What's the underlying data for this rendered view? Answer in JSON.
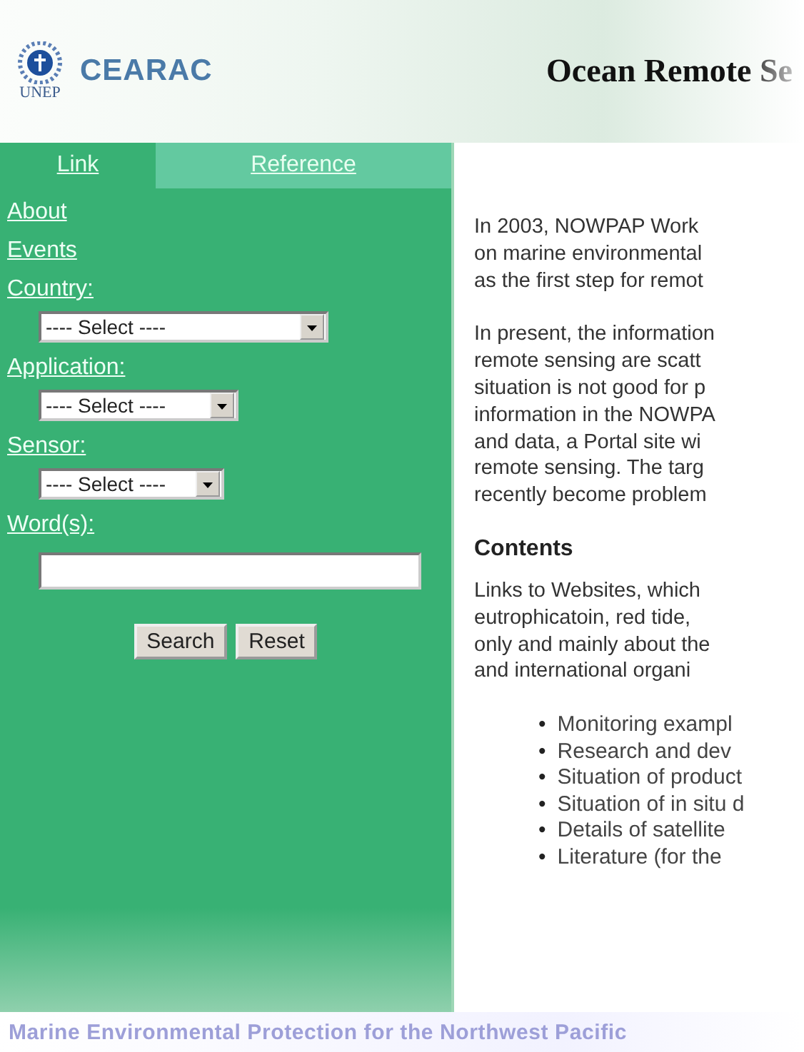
{
  "header": {
    "org": "UNEP",
    "logo_text": "CEARAC",
    "title": "Ocean Remote Se"
  },
  "tabs": [
    {
      "label": "Link",
      "selected": true
    },
    {
      "label": "Reference",
      "selected": false
    }
  ],
  "sidebar": {
    "items": [
      {
        "kind": "link",
        "label": "About"
      },
      {
        "kind": "link",
        "label": "Events"
      },
      {
        "kind": "link",
        "label": "Country:"
      },
      {
        "kind": "select",
        "value": "---- Select ----"
      },
      {
        "kind": "link",
        "label": "Application:"
      },
      {
        "kind": "select",
        "value": "---- Select ----"
      },
      {
        "kind": "link",
        "label": "Sensor:"
      },
      {
        "kind": "select",
        "value": "---- Select ----"
      },
      {
        "kind": "link",
        "label": "Word(s):"
      },
      {
        "kind": "input"
      }
    ],
    "buttons": [
      "Search",
      "Reset"
    ]
  },
  "content": {
    "blocks": [
      {
        "kind": "paragraph",
        "lines": [
          "In 2003, NOWPAP Work",
          "on marine environmental",
          "as the first step for remot"
        ]
      },
      {
        "kind": "paragraph",
        "lines": [
          "In present, the information",
          "remote sensing are scatt",
          "situation is not good for p",
          "information in the NOWPA",
          "and data, a Portal site wi",
          "remote sensing. The targ",
          "recently become problem"
        ]
      },
      {
        "kind": "heading",
        "text": "Contents"
      },
      {
        "kind": "paragraph",
        "lines": [
          "Links to Websites, which",
          "eutrophicatoin, red tide,",
          "only and mainly about the",
          "and international organi"
        ]
      },
      {
        "kind": "list",
        "bullet": "•",
        "items": [
          "Monitoring exampl",
          "Research and dev",
          "Situation of product",
          "Situation of in situ d",
          "Details of satellite",
          "Literature (for the"
        ]
      }
    ]
  },
  "footer": "Marine Environmental Protection for the Northwest Pacific"
}
